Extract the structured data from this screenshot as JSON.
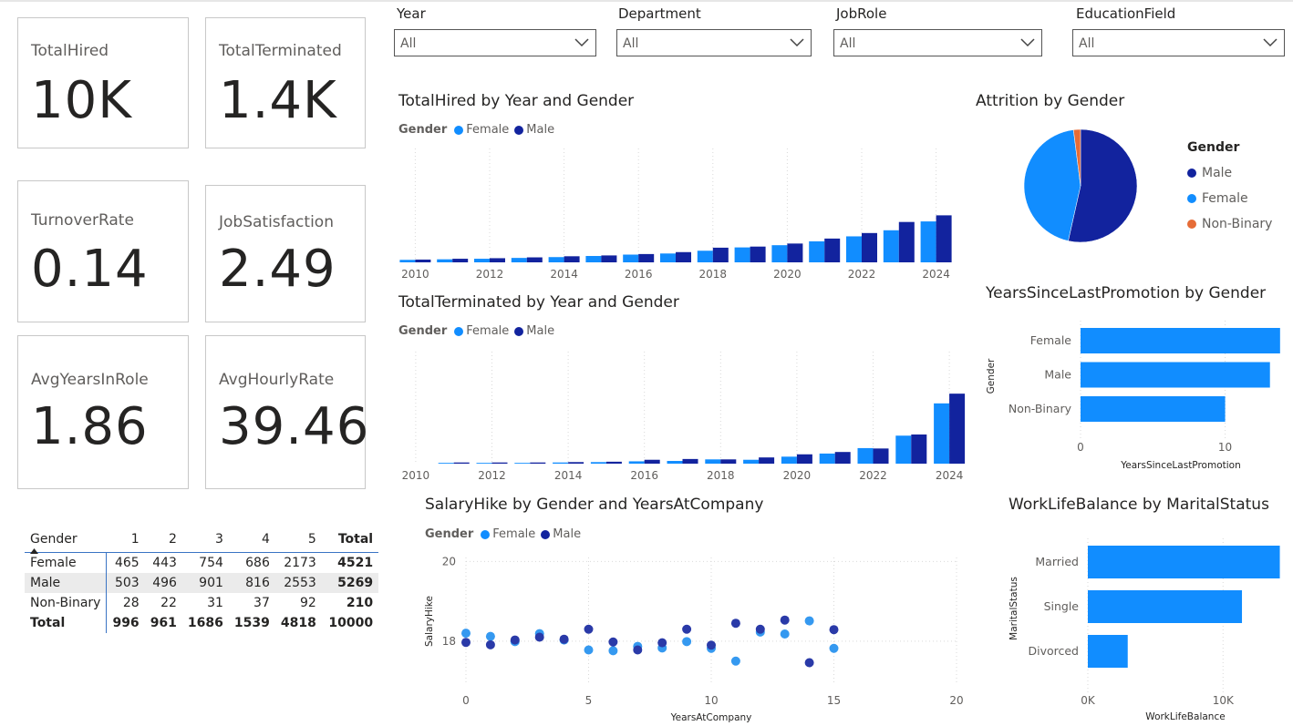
{
  "cards": {
    "total_hired": {
      "label": "TotalHired",
      "value": "10K"
    },
    "total_terminated": {
      "label": "TotalTerminated",
      "value": "1.4K"
    },
    "turnover_rate": {
      "label": "TurnoverRate",
      "value": "0.14"
    },
    "job_satisfaction": {
      "label": "JobSatisfaction",
      "value": "2.49"
    },
    "avg_years_in_role": {
      "label": "AvgYearsInRole",
      "value": "1.86"
    },
    "avg_hourly_rate": {
      "label": "AvgHourlyRate",
      "value": "39.46"
    }
  },
  "slicers": {
    "year": {
      "label": "Year",
      "value": "All"
    },
    "department": {
      "label": "Department",
      "value": "All"
    },
    "jobrole": {
      "label": "JobRole",
      "value": "All"
    },
    "education": {
      "label": "EducationField",
      "value": "All"
    }
  },
  "colors": {
    "female": "#118dff",
    "male": "#12239e",
    "nonbinary": "#e66c37",
    "bar": "#118dff",
    "scatter_female": "#3599f0",
    "scatter_male": "#2a3aa8"
  },
  "legend": {
    "title": "Gender",
    "female": "Female",
    "male": "Male",
    "nonbinary": "Non-Binary"
  },
  "matrix": {
    "corner": "Gender",
    "columns": [
      "1",
      "2",
      "3",
      "4",
      "5",
      "Total"
    ],
    "rows": [
      {
        "label": "Female",
        "values": [
          "465",
          "443",
          "754",
          "686",
          "2173",
          "4521"
        ]
      },
      {
        "label": "Male",
        "values": [
          "503",
          "496",
          "901",
          "816",
          "2553",
          "5269"
        ]
      },
      {
        "label": "Non-Binary",
        "values": [
          "28",
          "22",
          "31",
          "37",
          "92",
          "210"
        ]
      }
    ],
    "total": {
      "label": "Total",
      "values": [
        "996",
        "961",
        "1686",
        "1539",
        "4818",
        "10000"
      ]
    }
  },
  "chart_data": [
    {
      "id": "hired",
      "type": "bar",
      "title": "TotalHired by Year and Gender",
      "categories": [
        2010,
        2011,
        2012,
        2013,
        2014,
        2015,
        2016,
        2017,
        2018,
        2019,
        2020,
        2021,
        2022,
        2023,
        2024
      ],
      "tick_labels": [
        "2010",
        "2012",
        "2014",
        "2016",
        "2018",
        "2020",
        "2022",
        "2024"
      ],
      "ylim": [
        0,
        1400
      ],
      "series": [
        {
          "name": "Female",
          "values": [
            45,
            55,
            65,
            80,
            95,
            115,
            140,
            160,
            210,
            270,
            310,
            380,
            470,
            580,
            740
          ]
        },
        {
          "name": "Male",
          "values": [
            50,
            65,
            75,
            90,
            110,
            125,
            150,
            185,
            265,
            285,
            340,
            430,
            530,
            730,
            850
          ]
        }
      ]
    },
    {
      "id": "terminated",
      "type": "bar",
      "title": "TotalTerminated by Year and Gender",
      "categories": [
        2010,
        2011,
        2012,
        2013,
        2014,
        2015,
        2016,
        2017,
        2018,
        2019,
        2020,
        2021,
        2022,
        2023,
        2024
      ],
      "tick_labels": [
        "2010",
        "2012",
        "2014",
        "2016",
        "2018",
        "2020",
        "2022",
        "2024"
      ],
      "ylim": [
        0,
        260
      ],
      "series": [
        {
          "name": "Female",
          "values": [
            0,
            2,
            2,
            2,
            3,
            4,
            6,
            7,
            11,
            10,
            18,
            26,
            40,
            72,
            155
          ]
        },
        {
          "name": "Male",
          "values": [
            0,
            3,
            3,
            3,
            4,
            5,
            10,
            12,
            11,
            16,
            24,
            30,
            39,
            75,
            180
          ]
        }
      ]
    },
    {
      "id": "attrition",
      "type": "pie",
      "title": "Attrition by Gender",
      "series": [
        {
          "name": "Male",
          "value": 53.5
        },
        {
          "name": "Female",
          "value": 44.5
        },
        {
          "name": "Non-Binary",
          "value": 2
        }
      ]
    },
    {
      "id": "promotion",
      "type": "bar",
      "title": "YearsSinceLastPromotion by Gender",
      "orientation": "horizontal",
      "categories": [
        "Female",
        "Male",
        "Non-Binary"
      ],
      "values": [
        13.8,
        13.1,
        10.0
      ],
      "xlabel": "YearsSinceLastPromotion",
      "ylabel": "Gender",
      "xlim": [
        0,
        14
      ],
      "ticks": [
        "0",
        "10"
      ]
    },
    {
      "id": "salary",
      "type": "scatter",
      "title": "SalaryHike by Gender and YearsAtCompany",
      "xlabel": "YearsAtCompany",
      "ylabel": "SalaryHike",
      "xlim": [
        0,
        20
      ],
      "ylim": [
        16.9,
        20.1
      ],
      "xticks": [
        "0",
        "5",
        "10",
        "15",
        "20"
      ],
      "yticks": [
        "18",
        "20"
      ],
      "series": [
        {
          "name": "Female",
          "points": [
            [
              0,
              18.2
            ],
            [
              1,
              18.12
            ],
            [
              2,
              17.99
            ],
            [
              3,
              18.19
            ],
            [
              4,
              18.03
            ],
            [
              5,
              17.78
            ],
            [
              6,
              17.76
            ],
            [
              7,
              17.87
            ],
            [
              8,
              17.83
            ],
            [
              9,
              17.99
            ],
            [
              10,
              17.82
            ],
            [
              11,
              17.5
            ],
            [
              12,
              18.23
            ],
            [
              13,
              18.18
            ],
            [
              14,
              18.51
            ],
            [
              15,
              17.82
            ]
          ]
        },
        {
          "name": "Male",
          "points": [
            [
              0,
              17.97
            ],
            [
              1,
              17.91
            ],
            [
              2,
              18.03
            ],
            [
              3,
              18.1
            ],
            [
              4,
              18.05
            ],
            [
              5,
              18.3
            ],
            [
              6,
              17.98
            ],
            [
              7,
              17.78
            ],
            [
              8,
              17.96
            ],
            [
              9,
              18.3
            ],
            [
              10,
              17.9
            ],
            [
              11,
              18.45
            ],
            [
              12,
              18.3
            ],
            [
              13,
              18.53
            ],
            [
              14,
              17.46
            ],
            [
              15,
              18.29
            ]
          ]
        }
      ]
    },
    {
      "id": "worklife",
      "type": "bar",
      "title": "WorkLifeBalance by MaritalStatus",
      "orientation": "horizontal",
      "categories": [
        "Married",
        "Single",
        "Divorced"
      ],
      "values": [
        14200,
        11400,
        2950
      ],
      "xlabel": "WorkLifeBalance",
      "ylabel": "MaritalStatus",
      "xlim": [
        0,
        14500
      ],
      "ticks": [
        "0K",
        "10K"
      ]
    }
  ]
}
